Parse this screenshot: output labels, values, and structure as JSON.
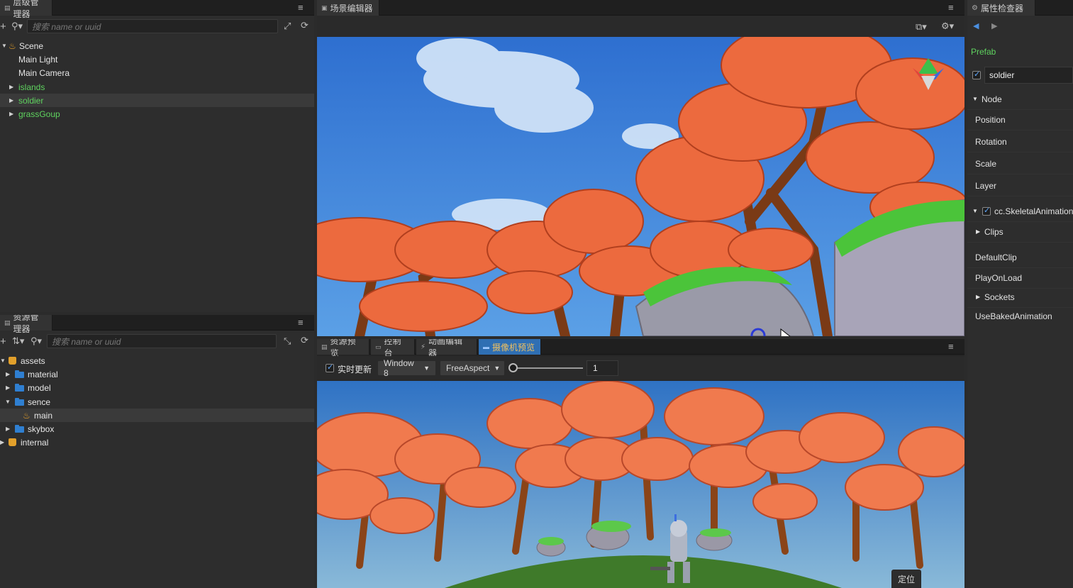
{
  "hierarchy": {
    "tab_label": "层级管理器",
    "search_placeholder": "搜索 name or uuid",
    "items": [
      {
        "label": "Scene"
      },
      {
        "label": "Main Light"
      },
      {
        "label": "Main Camera"
      },
      {
        "label": "islands"
      },
      {
        "label": "soldier"
      },
      {
        "label": "grassGoup"
      }
    ]
  },
  "assets": {
    "tab_label": "资源管理器",
    "search_placeholder": "搜索 name or uuid",
    "items": [
      {
        "label": "assets"
      },
      {
        "label": "material"
      },
      {
        "label": "model"
      },
      {
        "label": "sence"
      },
      {
        "label": "main"
      },
      {
        "label": "skybox"
      },
      {
        "label": "internal"
      }
    ]
  },
  "scene_editor": {
    "tab_label": "场景编辑器"
  },
  "bottom_tabs": [
    {
      "label": "资源预览"
    },
    {
      "label": "控制台"
    },
    {
      "label": "动画编辑器"
    },
    {
      "label": "摄像机预览"
    }
  ],
  "camera_preview": {
    "realtime_label": "实时更新",
    "window_label": "Window 8",
    "aspect_label": "FreeAspect",
    "value": "1",
    "locate_label": "定位"
  },
  "inspector": {
    "tab_label": "属性检查器",
    "prefab_label": "Prefab",
    "node_name": "soldier",
    "node_section": "Node",
    "props": [
      "Position",
      "Rotation",
      "Scale",
      "Layer"
    ],
    "component": "cc.SkeletalAnimation",
    "clips_label": "Clips",
    "default_clip": "DefaultClip",
    "play_on_load": "PlayOnLoad",
    "sockets_label": "Sockets",
    "use_baked": "UseBakedAnimation"
  },
  "colors": {
    "accent_blue": "#2f6fb3",
    "prefab_green": "#5fd35f",
    "folder_blue": "#2f7fd1",
    "asset_orange": "#e2a02b"
  }
}
